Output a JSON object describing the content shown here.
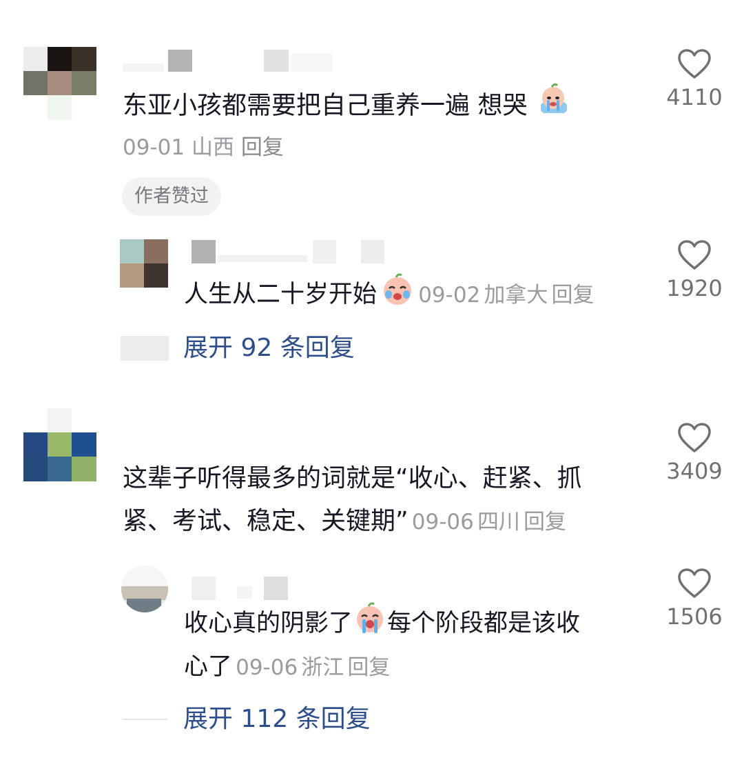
{
  "comments": [
    {
      "text": "东亚小孩都需要把自己重养一遍 想哭",
      "emoji": "crying-face-emoji",
      "date": "09-01",
      "location": "山西",
      "reply_label": "回复",
      "likes": "4110",
      "badge": "作者赞过",
      "replies": [
        {
          "text": "人生从二十岁开始",
          "emoji": "crying-face-emoji",
          "date": "09-02",
          "location": "加拿大",
          "reply_label": "回复",
          "likes": "1920"
        }
      ],
      "expand_label": "展开 92 条回复"
    },
    {
      "text_line1": "这辈子听得最多的词就是“收心、赶紧、抓",
      "text_line2": "紧、考试、稳定、关键期”",
      "date": "09-06",
      "location": "四川",
      "reply_label": "回复",
      "likes": "3409",
      "replies": [
        {
          "text_line1a": "收心真的阴影了",
          "emoji": "crying-face-emoji",
          "text_line1b": "每个阶段都是该收",
          "text_line2": "心了",
          "date": "09-06",
          "location": "浙江",
          "reply_label": "回复",
          "likes": "1506"
        }
      ],
      "expand_label": "展开 112 条回复"
    }
  ],
  "icons": {
    "like": "heart-outline-icon"
  },
  "colors": {
    "text": "#161823",
    "meta": "#9a9ba0",
    "link": "#2d4e8a",
    "badge_bg": "#f2f2f3"
  }
}
